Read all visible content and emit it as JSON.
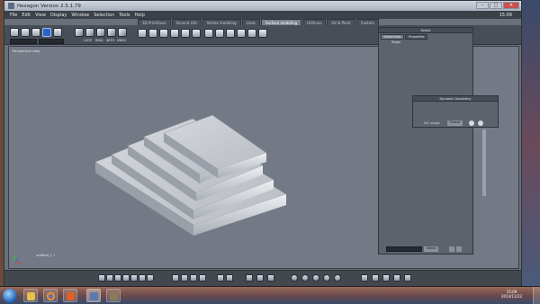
{
  "window": {
    "title": "Hexagon Version 2.5.1.79"
  },
  "menu": {
    "items": [
      "File",
      "Edit",
      "View",
      "Display",
      "Window",
      "Selection",
      "Tools",
      "Help"
    ],
    "clock": "15:09"
  },
  "tabs": [
    "3D Primitives",
    "Second Life",
    "Vertex modeling",
    "Lines",
    "Surface modeling",
    "UV/lines",
    "UV & Paint",
    "Custom"
  ],
  "active_tab": "Surface modeling",
  "toolbar": {
    "group_labels": [
      "LOOP",
      "RING",
      "WITH",
      "UNDO"
    ]
  },
  "viewport": {
    "label": "Perspective view",
    "filename": "untitled_1 *"
  },
  "scene_panel": {
    "title": "Scene",
    "tabs": [
      "Scene tree",
      "Properties"
    ],
    "tree": [
      "Steps"
    ]
  },
  "dynamic_panel": {
    "title": "Dynamic Geometry",
    "label": "DG mode:",
    "mode_value": "Freeze"
  },
  "scene_footer": {
    "button": "Select"
  },
  "taskbar": {
    "time": "15:09",
    "date": "2014/11/22"
  }
}
